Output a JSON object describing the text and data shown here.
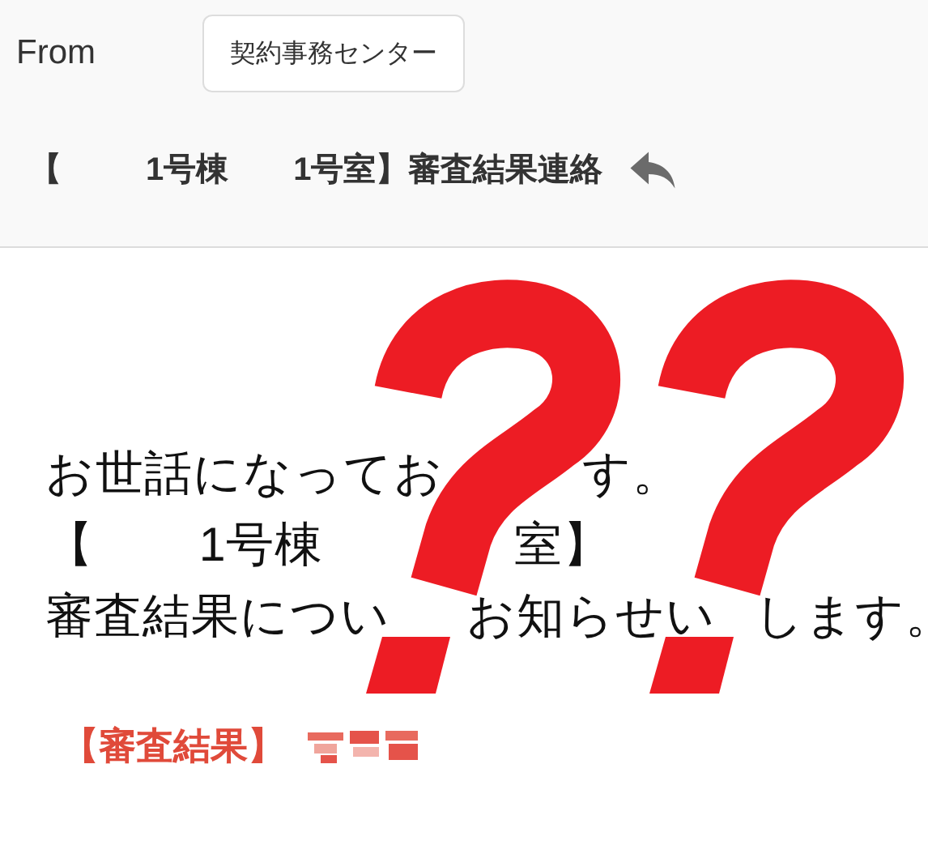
{
  "header": {
    "from_label": "From",
    "sender": "契約事務センター",
    "subject_parts": [
      "【",
      "1号棟",
      "1号室】審査結果連絡"
    ]
  },
  "body": {
    "lines": [
      {
        "parts": [
          "お世話になってお",
          "す。"
        ]
      },
      {
        "parts": [
          "【",
          "1号棟",
          "室】"
        ]
      },
      {
        "parts": [
          "審査結果につい",
          "お知らせい",
          "します。"
        ]
      }
    ],
    "result_label": "【審査結果】"
  }
}
